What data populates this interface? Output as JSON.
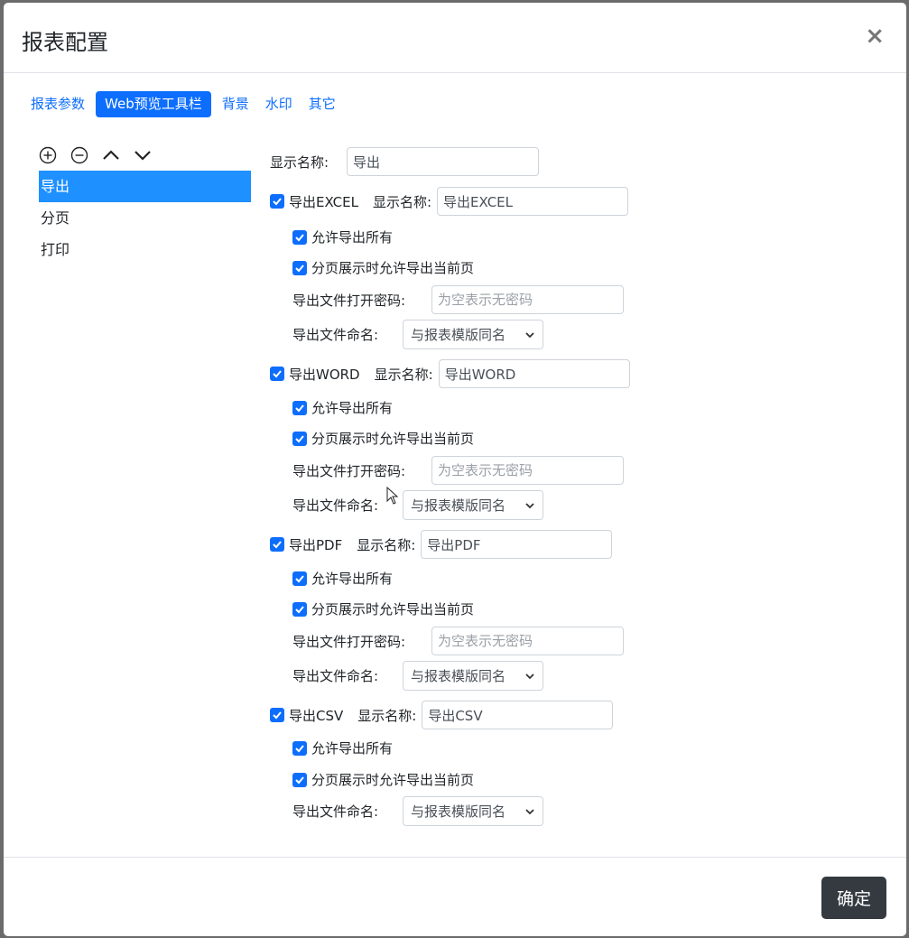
{
  "dialog": {
    "title": "报表配置",
    "close_symbol": "×"
  },
  "tabs": [
    {
      "label": "报表参数",
      "active": false
    },
    {
      "label": "Web预览工具栏",
      "active": true
    },
    {
      "label": "背景",
      "active": false
    },
    {
      "label": "水印",
      "active": false
    },
    {
      "label": "其它",
      "active": false
    }
  ],
  "toolbar_icons": [
    "plus-circle-icon",
    "minus-circle-icon",
    "chevron-up-icon",
    "chevron-down-icon"
  ],
  "left_list": [
    {
      "label": "导出",
      "selected": true
    },
    {
      "label": "分页",
      "selected": false
    },
    {
      "label": "打印",
      "selected": false
    }
  ],
  "form": {
    "display_name_label": "显示名称:",
    "display_name_value": "导出",
    "sections": [
      {
        "checkbox_label": "导出EXCEL",
        "name_label": "显示名称:",
        "name_value": "导出EXCEL",
        "allow_all_label": "允许导出所有",
        "allow_page_label": "分页展示时允许导出当前页",
        "password_label": "导出文件打开密码:",
        "password_placeholder": "为空表示无密码",
        "naming_label": "导出文件命名:",
        "naming_value": "与报表模版同名"
      },
      {
        "checkbox_label": "导出WORD",
        "name_label": "显示名称:",
        "name_value": "导出WORD",
        "allow_all_label": "允许导出所有",
        "allow_page_label": "分页展示时允许导出当前页",
        "password_label": "导出文件打开密码:",
        "password_placeholder": "为空表示无密码",
        "naming_label": "导出文件命名:",
        "naming_value": "与报表模版同名"
      },
      {
        "checkbox_label": "导出PDF",
        "name_label": "显示名称:",
        "name_value": "导出PDF",
        "allow_all_label": "允许导出所有",
        "allow_page_label": "分页展示时允许导出当前页",
        "password_label": "导出文件打开密码:",
        "password_placeholder": "为空表示无密码",
        "naming_label": "导出文件命名:",
        "naming_value": "与报表模版同名"
      },
      {
        "checkbox_label": "导出CSV",
        "name_label": "显示名称:",
        "name_value": "导出CSV",
        "allow_all_label": "允许导出所有",
        "allow_page_label": "分页展示时允许导出当前页",
        "naming_label": "导出文件命名:",
        "naming_value": "与报表模版同名"
      }
    ]
  },
  "footer": {
    "ok_label": "确定"
  },
  "colors": {
    "primary": "#0d6efd",
    "selected_row": "#1e90ff",
    "dark_button": "#343a40"
  }
}
